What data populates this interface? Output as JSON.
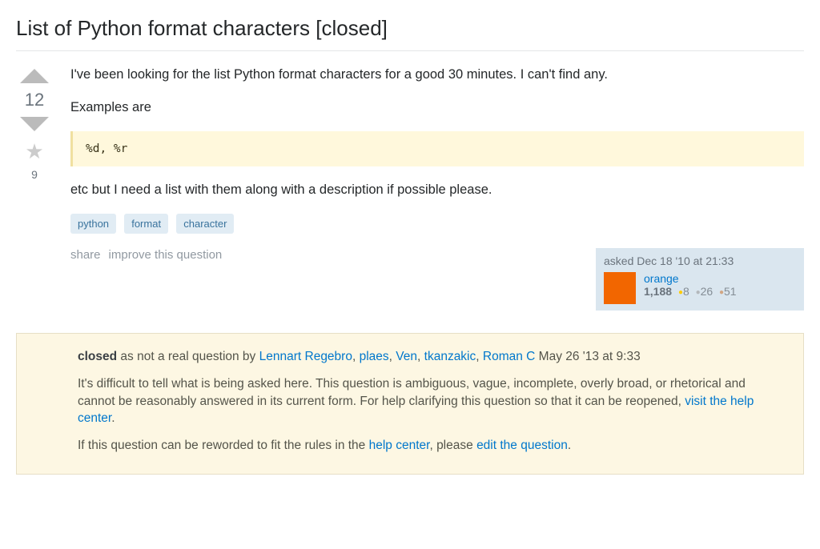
{
  "question": {
    "title": "List of Python format characters [closed]",
    "body1": "I've been looking for the list Python format characters for a good 30 minutes. I can't find any.",
    "body2": "Examples are",
    "code": "%d, %r",
    "body3": "etc but I need a list with them along with a description if possible please.",
    "vote_count": "12",
    "fav_count": "9",
    "tags": [
      "python",
      "format",
      "character"
    ],
    "actions": {
      "share": "share",
      "improve": "improve this question"
    }
  },
  "author_card": {
    "asked_label": "asked Dec 18 '10 at 21:33",
    "name": "orange",
    "reputation": "1,188",
    "gold": "8",
    "silver": "26",
    "bronze": "51"
  },
  "closed": {
    "label": "closed",
    "as_text": " as not a real question by ",
    "users": [
      "Lennart Regebro",
      "plaes",
      "Ven",
      "tkanzakic",
      "Roman C"
    ],
    "date": " May 26 '13 at 9:33",
    "reason1": "It's difficult to tell what is being asked here. This question is ambiguous, vague, incomplete, overly broad, or rhetorical and cannot be reasonably answered in its current form. For help clarifying this question so that it can be reopened, ",
    "help_link1": "visit the help center",
    "reason2_a": "If this question can be reworded to fit the rules in the ",
    "help_link2": "help center",
    "reason2_b": ", please ",
    "edit_link": "edit the question"
  }
}
